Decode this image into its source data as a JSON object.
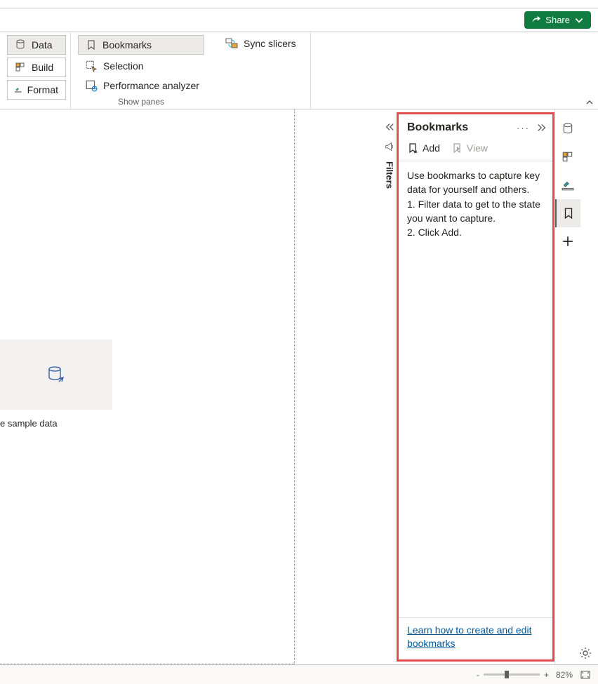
{
  "share": {
    "label": "Share"
  },
  "ribbon": {
    "data_label": "Data",
    "build_label": "Build",
    "format_label": "Format",
    "bookmarks_label": "Bookmarks",
    "selection_label": "Selection",
    "performance_label": "Performance analyzer",
    "sync_slicers_label": "Sync slicers",
    "show_panes_label": "Show panes"
  },
  "filters": {
    "label": "Filters"
  },
  "canvas": {
    "sample_label": "e sample data"
  },
  "bookmarks": {
    "title": "Bookmarks",
    "add_label": "Add",
    "view_label": "View",
    "body_line1": "Use bookmarks to capture key data for yourself and others.",
    "body_line2": "1. Filter data to get to the state you want to capture.",
    "body_line3": "2. Click Add.",
    "footer_link": "Learn how to create and edit bookmarks"
  },
  "status": {
    "zoom_value": "82%"
  }
}
